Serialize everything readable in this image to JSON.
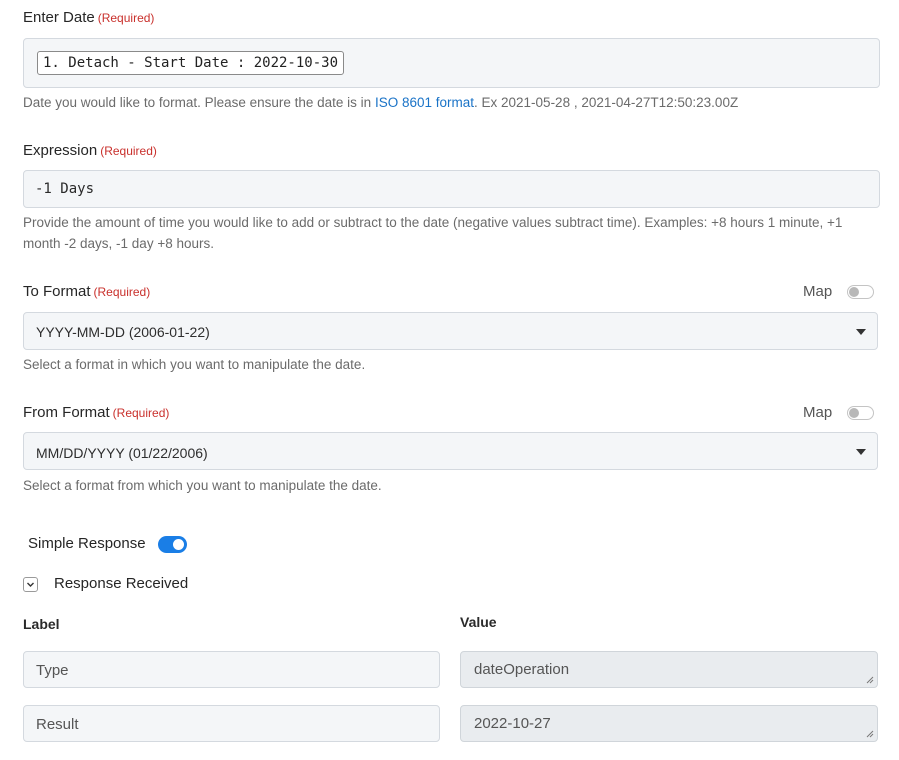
{
  "enter_date": {
    "label": "Enter Date",
    "required": "(Required)",
    "token": "1. Detach - Start Date : 2022-10-30",
    "help_prefix": "Date you would like to format. Please ensure the date is in ",
    "help_link": "ISO 8601 format",
    "help_suffix": ". Ex 2021-05-28 , 2021-04-27T12:50:23.00Z"
  },
  "expression": {
    "label": "Expression",
    "required": "(Required)",
    "value": "-1 Days",
    "help": "Provide the amount of time you would like to add or subtract to the date (negative values subtract time). Examples: +8 hours 1 minute, +1 month -2 days, -1 day +8 hours."
  },
  "to_format": {
    "label": "To Format",
    "required": "(Required)",
    "map_label": "Map",
    "selected": "YYYY-MM-DD (2006-01-22)",
    "help": "Select a format in which you want to manipulate the date."
  },
  "from_format": {
    "label": "From Format",
    "required": "(Required)",
    "map_label": "Map",
    "selected": "MM/DD/YYYY (01/22/2006)",
    "help": "Select a format from which you want to manipulate the date."
  },
  "simple_response": {
    "label": "Simple Response",
    "enabled": true
  },
  "response_received": {
    "label": "Response Received",
    "expanded": true
  },
  "response_table": {
    "label_header": "Label",
    "value_header": "Value",
    "rows": [
      {
        "label": "Type",
        "value": "dateOperation"
      },
      {
        "label": "Result",
        "value": "2022-10-27"
      }
    ]
  },
  "colors": {
    "accent": "#1a7ee6",
    "required": "#c9302c",
    "link": "#1a73c7"
  }
}
